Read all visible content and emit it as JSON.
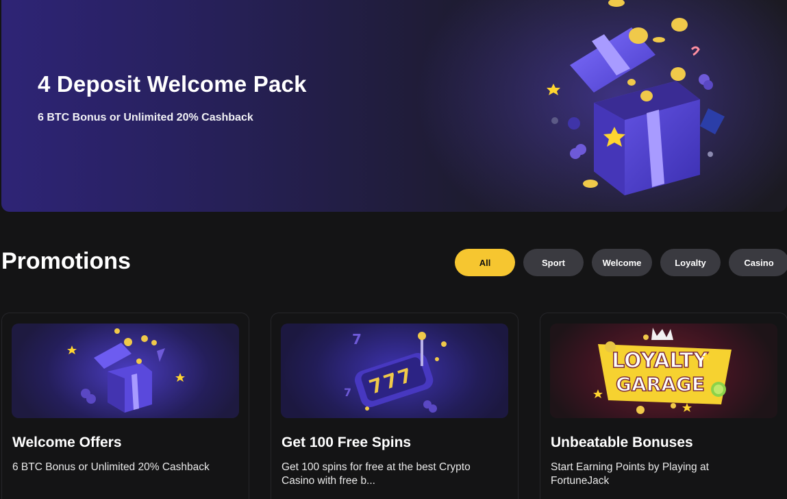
{
  "hero": {
    "title": "4 Deposit Welcome Pack",
    "subtitle": "6 BTC Bonus or Unlimited 20% Cashback"
  },
  "promotions": {
    "title": "Promotions",
    "filters": [
      {
        "label": "All",
        "active": true
      },
      {
        "label": "Sport",
        "active": false
      },
      {
        "label": "Welcome",
        "active": false
      },
      {
        "label": "Loyalty",
        "active": false
      },
      {
        "label": "Casino",
        "active": false
      }
    ],
    "cards": [
      {
        "title": "Welcome Offers",
        "description": "6 BTC Bonus or Unlimited 20% Cashback",
        "image": "gift-box-icon"
      },
      {
        "title": "Get 100 Free Spins",
        "description": "Get 100 spins for free at the best Crypto Casino with free b...",
        "image": "slot-reel-icon"
      },
      {
        "title": "Unbeatable Bonuses",
        "description": "Start Earning Points by Playing at FortuneJack",
        "image": "loyalty-garage-logo",
        "logo_text": [
          "LOYALTY",
          "GARAGE"
        ]
      }
    ]
  },
  "colors": {
    "accent": "#f6c630",
    "chip_bg": "#3a3a40",
    "background": "#141415",
    "hero_purple": "#2e2476"
  }
}
